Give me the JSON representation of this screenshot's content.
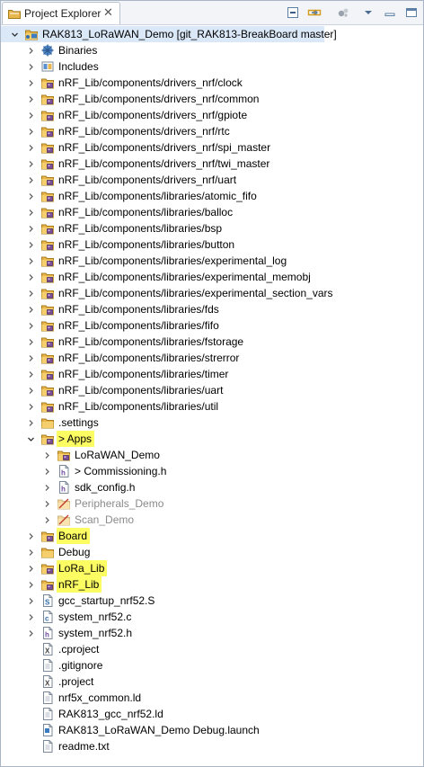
{
  "tab": {
    "title": "Project Explorer",
    "close_glyph": "✕"
  },
  "toolbar": [
    "collapse-all-icon",
    "link-with-editor-icon",
    "focus-icon",
    "view-menu-icon",
    "minimize-icon",
    "maximize-icon"
  ],
  "colors": {
    "highlight": "#fcfc63",
    "selection": "#dbe8f7",
    "folder": "#e8b64a",
    "disabled_text": "#8a8a8a"
  },
  "tree": [
    {
      "label": "RAK813_LoRaWAN_Demo [git_RAK813-BreakBoard master]",
      "depth": 0,
      "twisty": "expanded",
      "icon": "project-icon",
      "selected": true
    },
    {
      "label": "Binaries",
      "depth": 1,
      "twisty": "collapsed",
      "icon": "binaries-icon"
    },
    {
      "label": "Includes",
      "depth": 1,
      "twisty": "collapsed",
      "icon": "includes-icon"
    },
    {
      "label": "nRF_Lib/components/drivers_nrf/clock",
      "depth": 1,
      "twisty": "collapsed",
      "icon": "source-folder-icon"
    },
    {
      "label": "nRF_Lib/components/drivers_nrf/common",
      "depth": 1,
      "twisty": "collapsed",
      "icon": "source-folder-icon"
    },
    {
      "label": "nRF_Lib/components/drivers_nrf/gpiote",
      "depth": 1,
      "twisty": "collapsed",
      "icon": "source-folder-icon"
    },
    {
      "label": "nRF_Lib/components/drivers_nrf/rtc",
      "depth": 1,
      "twisty": "collapsed",
      "icon": "source-folder-icon"
    },
    {
      "label": "nRF_Lib/components/drivers_nrf/spi_master",
      "depth": 1,
      "twisty": "collapsed",
      "icon": "source-folder-icon"
    },
    {
      "label": "nRF_Lib/components/drivers_nrf/twi_master",
      "depth": 1,
      "twisty": "collapsed",
      "icon": "source-folder-icon"
    },
    {
      "label": "nRF_Lib/components/drivers_nrf/uart",
      "depth": 1,
      "twisty": "collapsed",
      "icon": "source-folder-icon"
    },
    {
      "label": "nRF_Lib/components/libraries/atomic_fifo",
      "depth": 1,
      "twisty": "collapsed",
      "icon": "source-folder-icon"
    },
    {
      "label": "nRF_Lib/components/libraries/balloc",
      "depth": 1,
      "twisty": "collapsed",
      "icon": "source-folder-icon"
    },
    {
      "label": "nRF_Lib/components/libraries/bsp",
      "depth": 1,
      "twisty": "collapsed",
      "icon": "source-folder-icon"
    },
    {
      "label": "nRF_Lib/components/libraries/button",
      "depth": 1,
      "twisty": "collapsed",
      "icon": "source-folder-icon"
    },
    {
      "label": "nRF_Lib/components/libraries/experimental_log",
      "depth": 1,
      "twisty": "collapsed",
      "icon": "source-folder-icon"
    },
    {
      "label": "nRF_Lib/components/libraries/experimental_memobj",
      "depth": 1,
      "twisty": "collapsed",
      "icon": "source-folder-icon"
    },
    {
      "label": "nRF_Lib/components/libraries/experimental_section_vars",
      "depth": 1,
      "twisty": "collapsed",
      "icon": "source-folder-icon"
    },
    {
      "label": "nRF_Lib/components/libraries/fds",
      "depth": 1,
      "twisty": "collapsed",
      "icon": "source-folder-icon"
    },
    {
      "label": "nRF_Lib/components/libraries/fifo",
      "depth": 1,
      "twisty": "collapsed",
      "icon": "source-folder-icon"
    },
    {
      "label": "nRF_Lib/components/libraries/fstorage",
      "depth": 1,
      "twisty": "collapsed",
      "icon": "source-folder-icon"
    },
    {
      "label": "nRF_Lib/components/libraries/strerror",
      "depth": 1,
      "twisty": "collapsed",
      "icon": "source-folder-icon"
    },
    {
      "label": "nRF_Lib/components/libraries/timer",
      "depth": 1,
      "twisty": "collapsed",
      "icon": "source-folder-icon"
    },
    {
      "label": "nRF_Lib/components/libraries/uart",
      "depth": 1,
      "twisty": "collapsed",
      "icon": "source-folder-icon"
    },
    {
      "label": "nRF_Lib/components/libraries/util",
      "depth": 1,
      "twisty": "collapsed",
      "icon": "source-folder-icon"
    },
    {
      "label": ".settings",
      "depth": 1,
      "twisty": "collapsed",
      "icon": "folder-icon"
    },
    {
      "label": "> Apps",
      "depth": 1,
      "twisty": "expanded",
      "icon": "source-folder-icon",
      "highlight": true
    },
    {
      "label": "LoRaWAN_Demo",
      "depth": 2,
      "twisty": "collapsed",
      "icon": "source-folder-icon"
    },
    {
      "label": "> Commissioning.h",
      "depth": 2,
      "twisty": "collapsed",
      "icon": "header-file-icon"
    },
    {
      "label": "sdk_config.h",
      "depth": 2,
      "twisty": "collapsed",
      "icon": "header-file-icon"
    },
    {
      "label": "Peripherals_Demo",
      "depth": 2,
      "twisty": "collapsed",
      "icon": "excluded-folder-icon",
      "dim": true
    },
    {
      "label": "Scan_Demo",
      "depth": 2,
      "twisty": "collapsed",
      "icon": "excluded-folder-icon",
      "dim": true
    },
    {
      "label": "Board",
      "depth": 1,
      "twisty": "collapsed",
      "icon": "source-folder-icon",
      "highlight": true
    },
    {
      "label": "Debug",
      "depth": 1,
      "twisty": "collapsed",
      "icon": "folder-icon"
    },
    {
      "label": "LoRa_Lib",
      "depth": 1,
      "twisty": "collapsed",
      "icon": "source-folder-icon",
      "highlight": true
    },
    {
      "label": "nRF_Lib",
      "depth": 1,
      "twisty": "collapsed",
      "icon": "source-folder-icon",
      "highlight": true
    },
    {
      "label": "gcc_startup_nrf52.S",
      "depth": 1,
      "twisty": "collapsed",
      "icon": "asm-file-icon"
    },
    {
      "label": "system_nrf52.c",
      "depth": 1,
      "twisty": "collapsed",
      "icon": "c-file-icon"
    },
    {
      "label": "system_nrf52.h",
      "depth": 1,
      "twisty": "collapsed",
      "icon": "header-file-icon"
    },
    {
      "label": ".cproject",
      "depth": 1,
      "twisty": "none",
      "icon": "xml-file-icon"
    },
    {
      "label": ".gitignore",
      "depth": 1,
      "twisty": "none",
      "icon": "file-icon"
    },
    {
      "label": ".project",
      "depth": 1,
      "twisty": "none",
      "icon": "xml-file-icon"
    },
    {
      "label": "nrf5x_common.ld",
      "depth": 1,
      "twisty": "none",
      "icon": "file-icon"
    },
    {
      "label": "RAK813_gcc_nrf52.ld",
      "depth": 1,
      "twisty": "none",
      "icon": "file-icon"
    },
    {
      "label": "RAK813_LoRaWAN_Demo Debug.launch",
      "depth": 1,
      "twisty": "none",
      "icon": "launch-file-icon"
    },
    {
      "label": "readme.txt",
      "depth": 1,
      "twisty": "none",
      "icon": "file-icon"
    }
  ]
}
